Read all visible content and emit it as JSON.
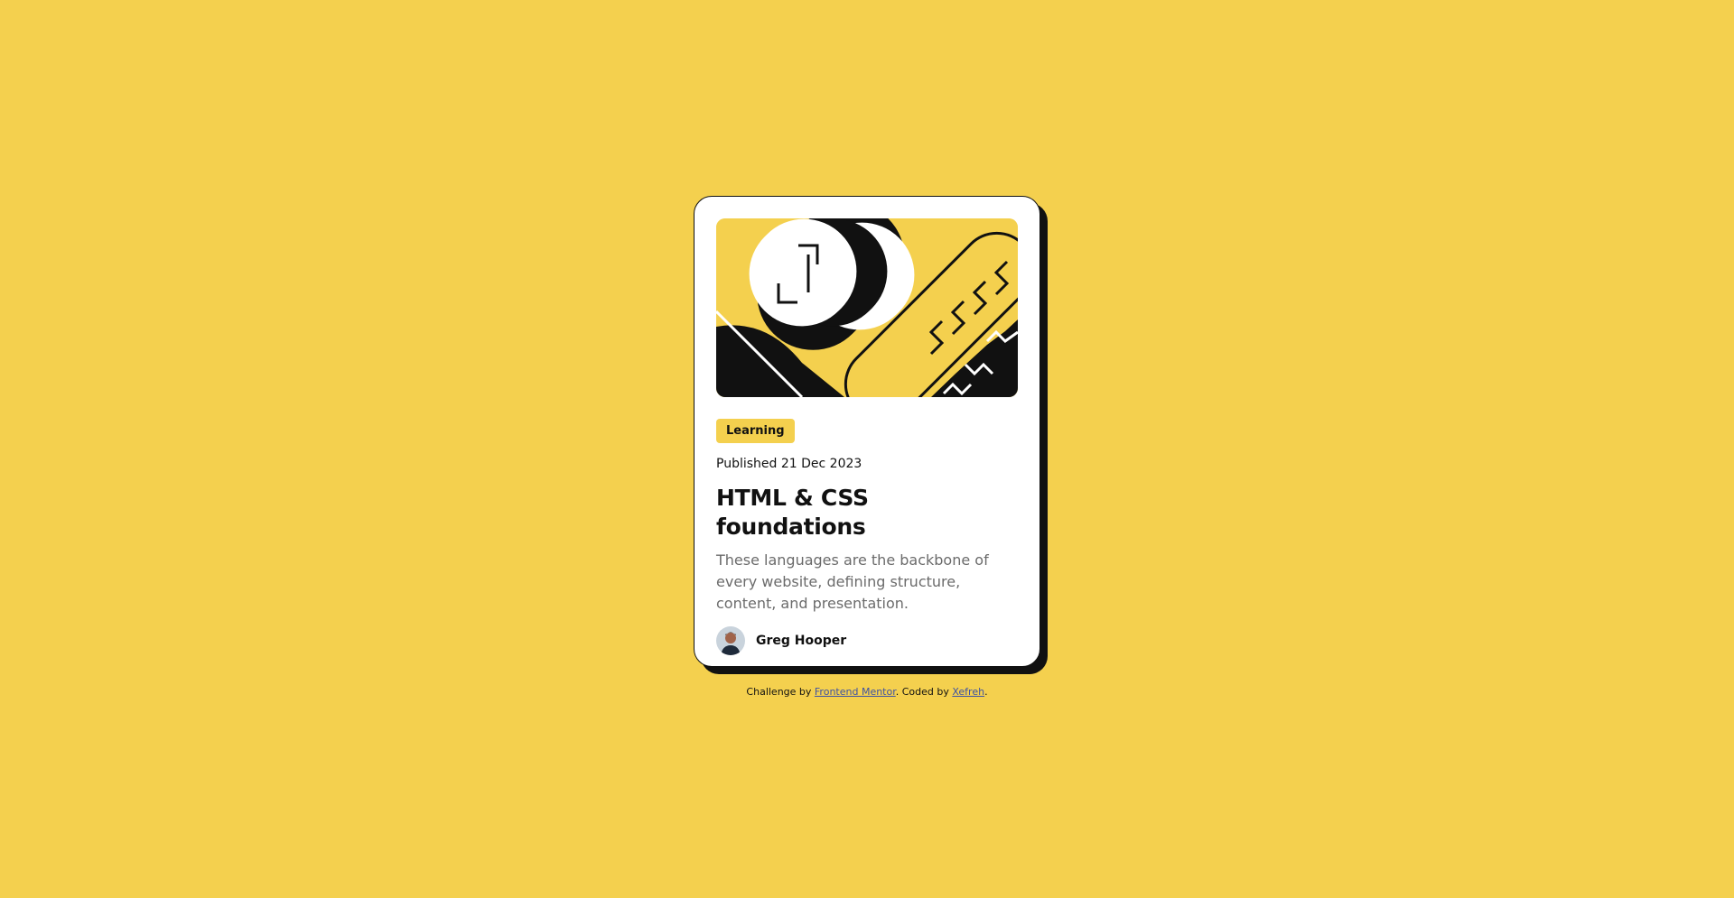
{
  "card": {
    "image_alt": "Illustration with abstract shapes",
    "tag": "Learning",
    "published": "Published 21 Dec 2023",
    "title": "HTML & CSS foundations",
    "description": "These languages are the backbone of every website, defining structure, content, and presentation.",
    "author": {
      "name": "Greg Hooper"
    }
  },
  "attribution": {
    "prefix": "Challenge by ",
    "link1": "Frontend Mentor",
    "middle": ". Coded by ",
    "link2": "Xefreh",
    "suffix": "."
  },
  "colors": {
    "background": "#F4D04E",
    "card": "#FFFFFF",
    "ink": "#111111",
    "muted": "#6B6B6B",
    "link": "#3E52A3"
  }
}
